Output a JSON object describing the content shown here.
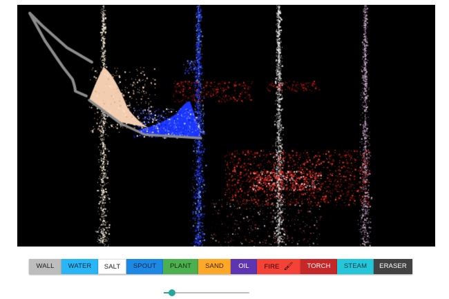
{
  "tools": [
    {
      "id": "wall",
      "label": "WALL",
      "bg": "#bdbdbd",
      "fg": "#212121"
    },
    {
      "id": "water",
      "label": "WATER",
      "bg": "#29b6f6",
      "fg": "#0d2740"
    },
    {
      "id": "salt",
      "label": "SALT",
      "bg": "#ffffff",
      "fg": "#212121",
      "selected": true
    },
    {
      "id": "spout",
      "label": "SPOUT",
      "bg": "#1e88e5",
      "fg": "#0d2740"
    },
    {
      "id": "plant",
      "label": "PLANT",
      "bg": "#4caf50",
      "fg": "#10300f"
    },
    {
      "id": "sand",
      "label": "SAND",
      "bg": "#ffa726",
      "fg": "#3e2600"
    },
    {
      "id": "oil",
      "label": "OIL",
      "bg": "#5e35b1",
      "fg": "#ffffff"
    },
    {
      "id": "fire",
      "label": "FIRE",
      "bg": "#f44336",
      "fg": "#3a0000",
      "brush_icon": "paintbrush-icon"
    },
    {
      "id": "torch",
      "label": "TORCH",
      "bg": "#c62828",
      "fg": "#ffffff"
    },
    {
      "id": "steam",
      "label": "STEAM",
      "bg": "#26c6da",
      "fg": "#073b41"
    },
    {
      "id": "eraser",
      "label": "ERASER",
      "bg": "#424242",
      "fg": "#ffffff"
    }
  ],
  "brush_size": {
    "value": 0.1,
    "thumb_color": "#26a69a",
    "track_color": "#bdbdbd"
  },
  "canvas": {
    "background": "#000000",
    "colors": {
      "wall": "#8c8c8c",
      "salt": "#f2cdb0",
      "water": "#1a36ff",
      "fire": "#d4201a",
      "steam": "#c9a9c2",
      "spout_stream": "#f0e8d8"
    }
  }
}
